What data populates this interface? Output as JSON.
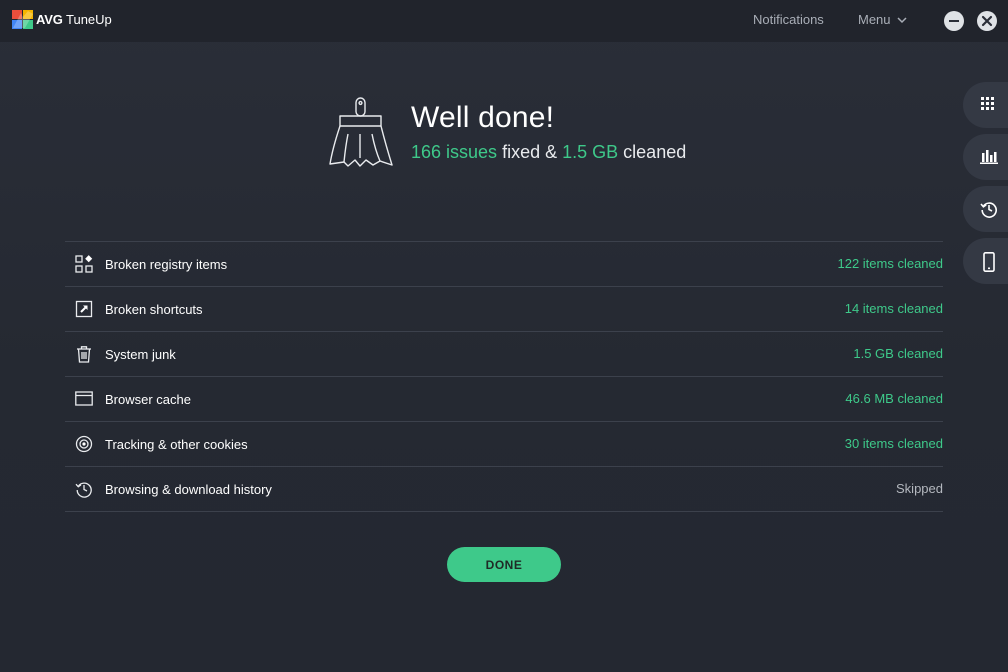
{
  "titlebar": {
    "brand": "AVG",
    "product": "TuneUp",
    "notifications_label": "Notifications",
    "menu_label": "Menu"
  },
  "header": {
    "title": "Well done!",
    "issues_count": "166 issues",
    "fixed_text": "fixed &",
    "cleaned_size": "1.5 GB",
    "cleaned_text": "cleaned"
  },
  "results": [
    {
      "label": "Broken registry items",
      "status": "122 items cleaned",
      "icon": "registry-icon"
    },
    {
      "label": "Broken shortcuts",
      "status": "14 items cleaned",
      "icon": "shortcut-icon"
    },
    {
      "label": "System junk",
      "status": "1.5 GB cleaned",
      "icon": "trash-icon"
    },
    {
      "label": "Browser cache",
      "status": "46.6 MB cleaned",
      "icon": "browser-window-icon"
    },
    {
      "label": "Tracking & other cookies",
      "status": "30 items cleaned",
      "icon": "target-icon"
    },
    {
      "label": "Browsing & download history",
      "status": "Skipped",
      "icon": "history-icon"
    }
  ],
  "done_label": "DONE",
  "colors": {
    "background": "#262a33",
    "titlebar": "#21242c",
    "accent_green": "#3ec98a",
    "rail_button": "#343944",
    "divider": "#3c414c"
  }
}
